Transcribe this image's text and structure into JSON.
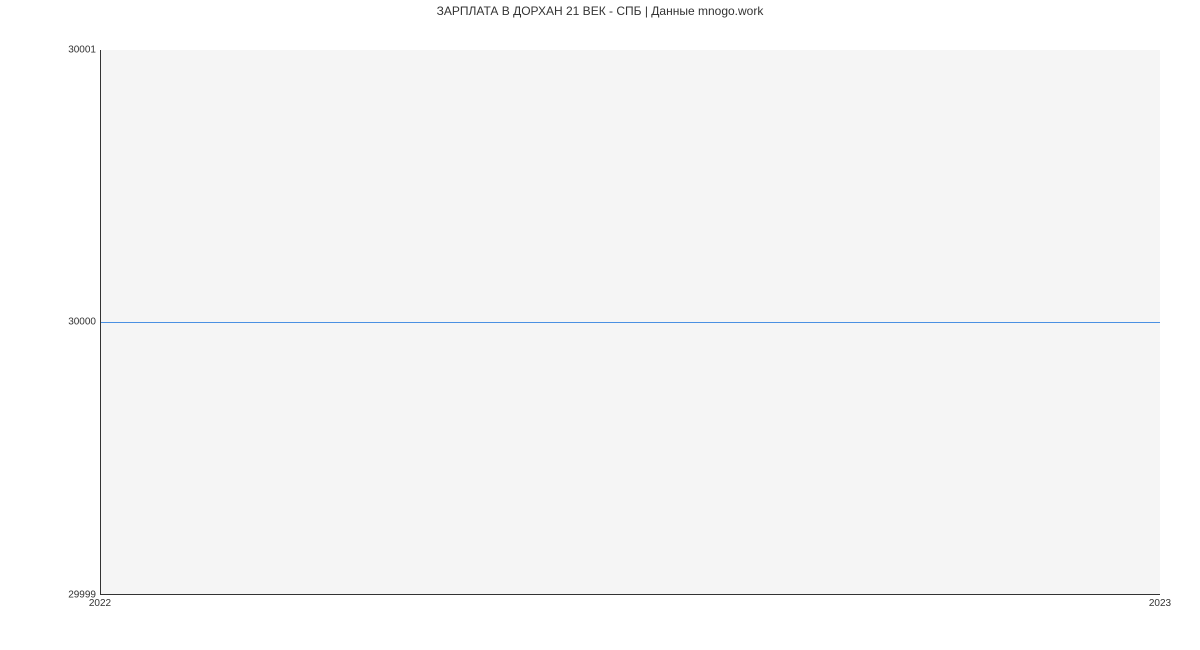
{
  "chart_data": {
    "type": "line",
    "title": "ЗАРПЛАТА В ДОРХАН 21 ВЕК - СПБ | Данные mnogo.work",
    "xlabel": "",
    "ylabel": "",
    "x": [
      2022,
      2023
    ],
    "values": [
      30000,
      30000
    ],
    "ylim": [
      29999,
      30001
    ],
    "xlim": [
      2022,
      2023
    ],
    "y_ticks": [
      29999,
      30000,
      30001
    ],
    "x_ticks": [
      2022,
      2023
    ],
    "line_color": "#4a90e2",
    "plot_bg": "#f5f5f5"
  }
}
